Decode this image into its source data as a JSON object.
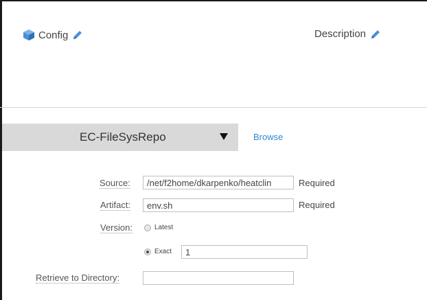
{
  "header": {
    "config_label": "Config",
    "description_label": "Description"
  },
  "repository": {
    "selected": "EC-FileSysRepo",
    "browse_label": "Browse"
  },
  "form": {
    "source": {
      "label": "Source:",
      "value": "/net/f2home/dkarpenko/heatclin",
      "hint": "Required"
    },
    "artifact": {
      "label": "Artifact:",
      "value": "env.sh",
      "hint": "Required"
    },
    "version": {
      "label": "Version:",
      "options": [
        {
          "label": "Latest",
          "selected": false
        },
        {
          "label": "Exact",
          "selected": true
        }
      ],
      "exact_value": "1"
    },
    "retrieve_dir": {
      "label": "Retrieve to Directory:",
      "value": ""
    }
  },
  "colors": {
    "accent": "#2b8ad1",
    "select_bg": "#d9d9d9",
    "icon_blue": "#4a90d9"
  }
}
